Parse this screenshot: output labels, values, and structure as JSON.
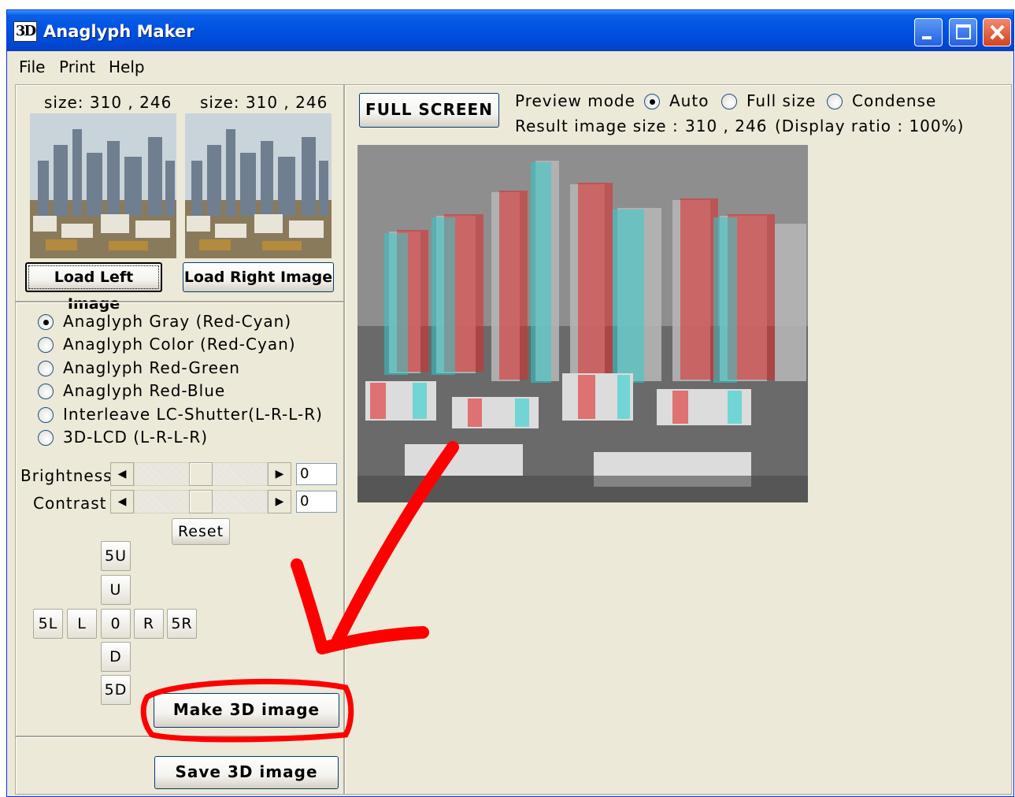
{
  "window": {
    "title": "Anaglyph Maker",
    "logo_text": "3D"
  },
  "menu": [
    "File",
    "Print",
    "Help"
  ],
  "left_image": {
    "size_label": "size: 310 , 246",
    "button": "Load Left Image"
  },
  "right_image": {
    "size_label": "size: 310 , 246",
    "button": "Load Right Image"
  },
  "modes": [
    {
      "label": "Anaglyph Gray (Red-Cyan)",
      "checked": true
    },
    {
      "label": "Anaglyph Color (Red-Cyan)",
      "checked": false
    },
    {
      "label": "Anaglyph Red-Green",
      "checked": false
    },
    {
      "label": "Anaglyph Red-Blue",
      "checked": false
    },
    {
      "label": "Interleave LC-Shutter(L-R-L-R)",
      "checked": false
    },
    {
      "label": "3D-LCD (L-R-L-R)",
      "checked": false
    }
  ],
  "brightness": {
    "label": "Brightness",
    "value": "0",
    "level": 0.5
  },
  "contrast": {
    "label": "Contrast",
    "value": "0",
    "level": 0.5
  },
  "reset_label": "Reset",
  "shift": {
    "up5": "5U",
    "up": "U",
    "left5": "5L",
    "left": "L",
    "center": "0",
    "right": "R",
    "right5": "5R",
    "down": "D",
    "down5": "5D"
  },
  "make_label": "Make 3D image",
  "save_label": "Save 3D image",
  "fullscreen_label": "FULL SCREEN",
  "preview": {
    "mode_label": "Preview mode",
    "options": [
      {
        "label": "Auto",
        "checked": true
      },
      {
        "label": "Full size",
        "checked": false
      },
      {
        "label": "Condense",
        "checked": false
      }
    ],
    "result_label": "Result image size :",
    "result_size": "310 , 246",
    "display_ratio": "(Display ratio : 100%)"
  },
  "colors": {
    "annotation": "#ff0000",
    "titlebar": "#0054e3",
    "face": "#ece9d8"
  }
}
